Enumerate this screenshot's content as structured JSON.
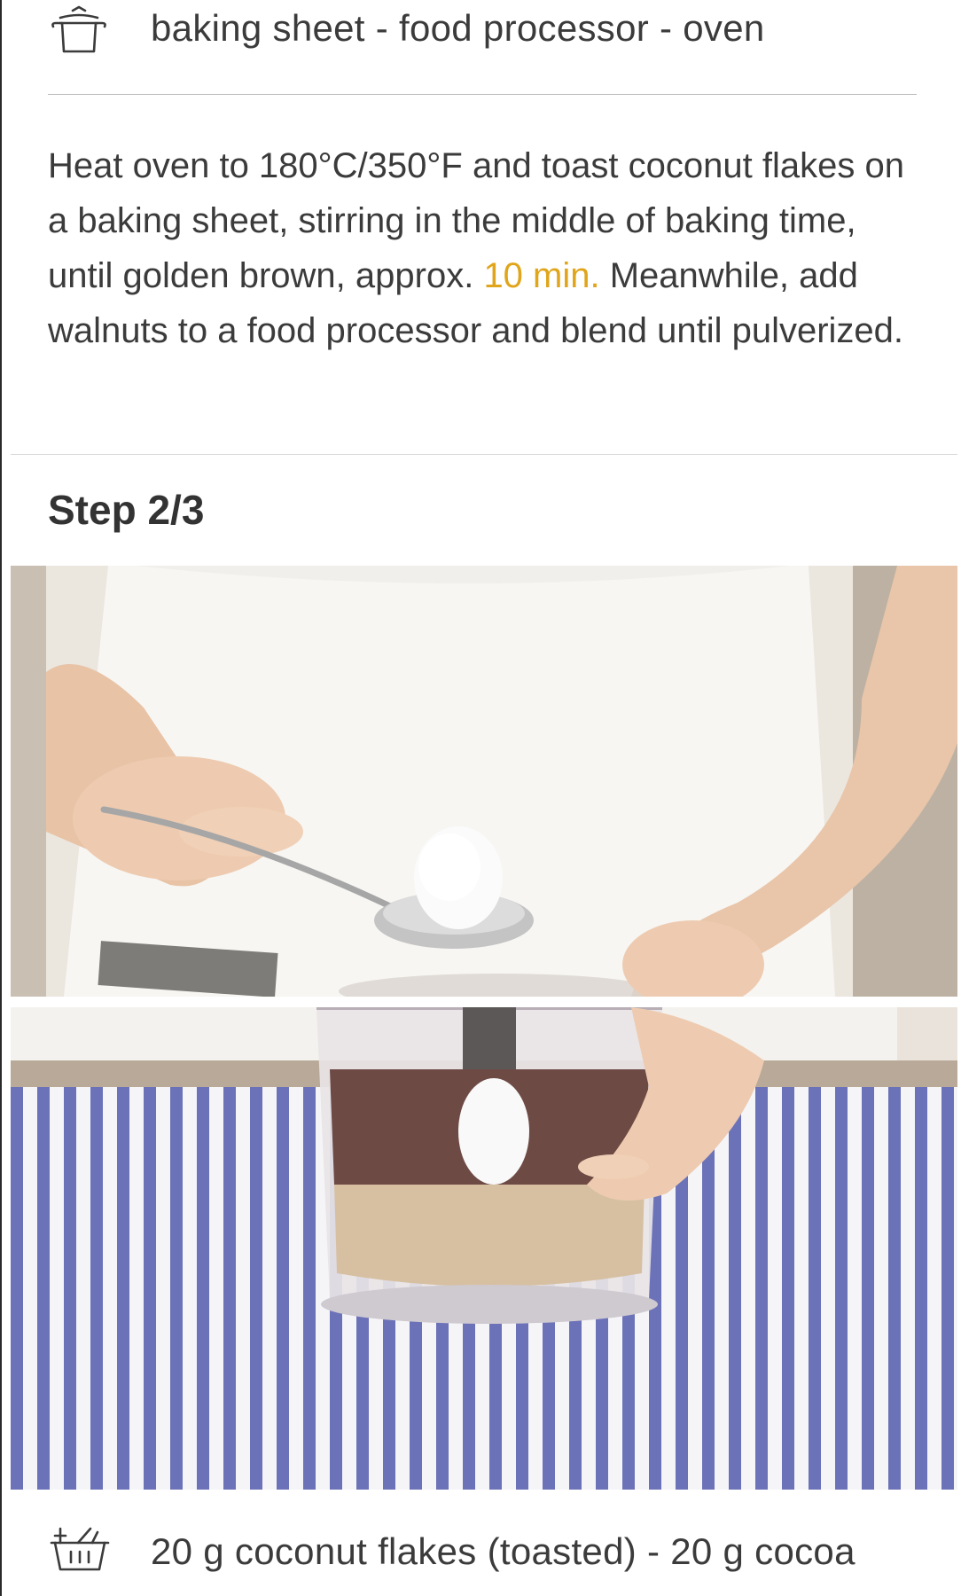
{
  "utensils": {
    "icon": "pot-icon",
    "text": "baking sheet - food processor - oven"
  },
  "description": {
    "text_before": "Heat oven to 180°C/350°F and toast coconut flakes on a baking sheet, stirring in the middle of baking time, until golden brown, approx. ",
    "timer": "10 min.",
    "text_after": " Meanwhile, add walnuts to a food processor and blend until pulverized."
  },
  "step": {
    "title": "Step 2/3"
  },
  "images": {
    "top": {
      "alt": "Hand holding a spoon of coconut oil above a food processor"
    },
    "bottom": {
      "alt": "Adding coconut oil into food processor bowl with ground walnuts"
    }
  },
  "ingredients": {
    "icon": "shopping-basket-icon",
    "text": "20 g coconut flakes (toasted) - 20 g cocoa"
  },
  "colors": {
    "timer": "#e0a51a",
    "text": "#3b3b3b",
    "divider": "#bdbdbd"
  }
}
